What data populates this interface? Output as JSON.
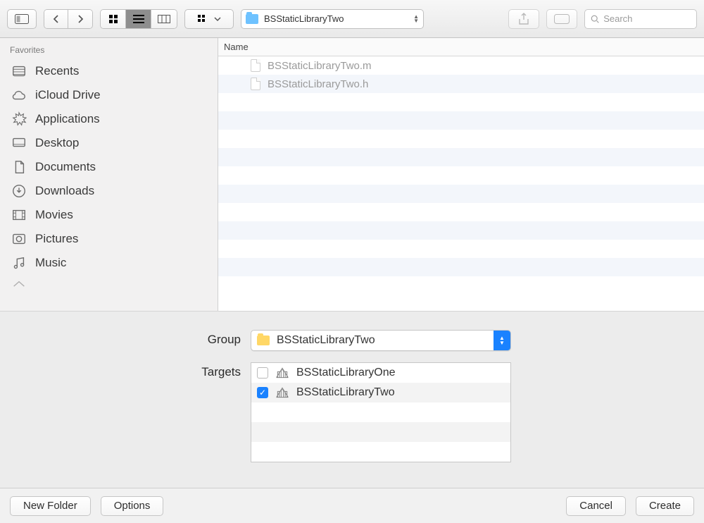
{
  "toolbar": {
    "path_label": "BSStaticLibraryTwo",
    "search_placeholder": "Search"
  },
  "sidebar": {
    "header": "Favorites",
    "items": [
      {
        "label": "Recents"
      },
      {
        "label": "iCloud Drive"
      },
      {
        "label": "Applications"
      },
      {
        "label": "Desktop"
      },
      {
        "label": "Documents"
      },
      {
        "label": "Downloads"
      },
      {
        "label": "Movies"
      },
      {
        "label": "Pictures"
      },
      {
        "label": "Music"
      }
    ]
  },
  "file_list": {
    "column_header": "Name",
    "files": [
      "BSStaticLibraryTwo.m",
      "BSStaticLibraryTwo.h"
    ]
  },
  "group_panel": {
    "group_label": "Group",
    "group_value": "BSStaticLibraryTwo",
    "targets_label": "Targets",
    "targets": [
      {
        "name": "BSStaticLibraryOne",
        "checked": false
      },
      {
        "name": "BSStaticLibraryTwo",
        "checked": true
      }
    ]
  },
  "bottom": {
    "new_folder": "New Folder",
    "options": "Options",
    "cancel": "Cancel",
    "create": "Create"
  }
}
